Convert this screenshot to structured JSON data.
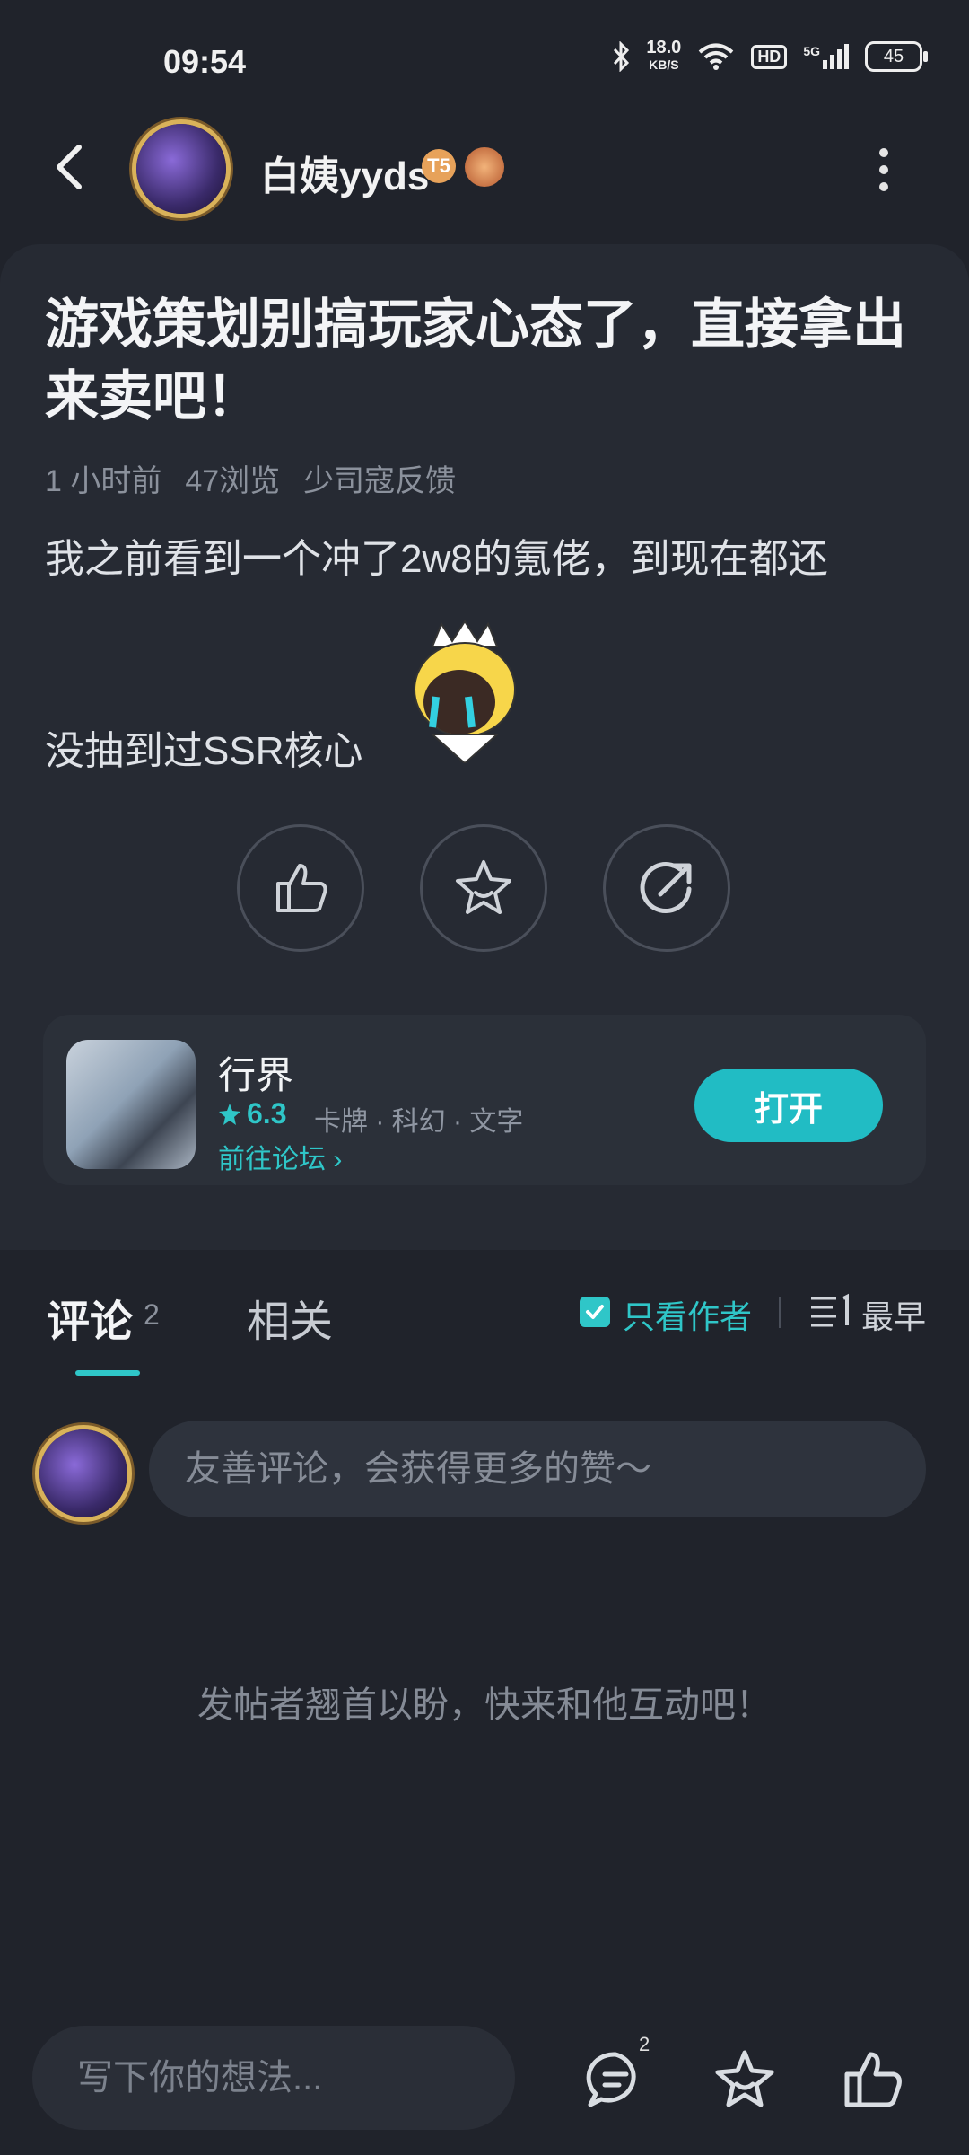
{
  "status_bar": {
    "time": "09:54",
    "net_speed_value": "18.0",
    "net_speed_unit": "KB/S",
    "hd": "HD",
    "signal": "5G",
    "battery": "45"
  },
  "header": {
    "username": "白姨yyds",
    "level_badge": "T5"
  },
  "post": {
    "title": "游戏策划别搞玩家心态了，直接拿出来卖吧！",
    "time_ago": "1 小时前",
    "views": "47浏览",
    "category": "少司寇反馈",
    "body_line1": "我之前看到一个冲了2w8的氪佬，到现在都还",
    "body_line2": "没抽到过SSR核心"
  },
  "app_card": {
    "name": "行界",
    "rating": "6.3",
    "tags": "卡牌 · 科幻 · 文字",
    "forum_link": "前往论坛",
    "open_label": "打开"
  },
  "comments": {
    "tab_comments": "评论",
    "comment_count": "2",
    "tab_related": "相关",
    "only_author": "只看作者",
    "sort_label": "最早",
    "input_placeholder": "友善评论，会获得更多的赞～",
    "empty_hint": "发帖者翘首以盼，快来和他互动吧！"
  },
  "bottom_bar": {
    "input_placeholder": "写下你的想法...",
    "comment_badge": "2"
  },
  "colors": {
    "accent": "#21bcc4",
    "background": "#20232b",
    "card": "#262a33"
  }
}
